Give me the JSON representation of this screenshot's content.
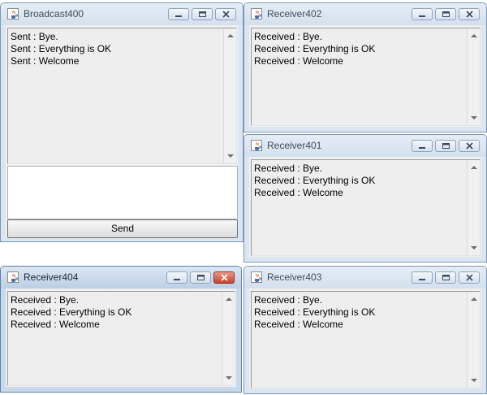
{
  "colors": {
    "accent_close": "#c5432e",
    "frame_inactive": "#dbe6f2",
    "frame_active": "#c9d9ec"
  },
  "icons": {
    "app": "java-cup-icon",
    "minimize": "minimize-icon",
    "maximize": "maximize-icon",
    "close": "close-icon",
    "scroll_up": "chevron-up-icon",
    "scroll_down": "chevron-down-icon"
  },
  "broadcast": {
    "title": "Broadcast400",
    "lines": [
      "Sent : Bye.",
      "Sent : Everything is OK",
      "Sent : Welcome"
    ],
    "input_value": "",
    "send_label": "Send"
  },
  "receiver402": {
    "title": "Receiver402",
    "lines": [
      "Received : Bye.",
      "Received : Everything is OK",
      "Received : Welcome"
    ]
  },
  "receiver401": {
    "title": "Receiver401",
    "lines": [
      "Received : Bye.",
      "Received : Everything is OK",
      "Received : Welcome"
    ]
  },
  "receiver404": {
    "title": "Receiver404",
    "lines": [
      "Received : Bye.",
      "Received : Everything is OK",
      "Received : Welcome"
    ]
  },
  "receiver403": {
    "title": "Receiver403",
    "lines": [
      "Received : Bye.",
      "Received : Everything is OK",
      "Received : Welcome"
    ]
  }
}
